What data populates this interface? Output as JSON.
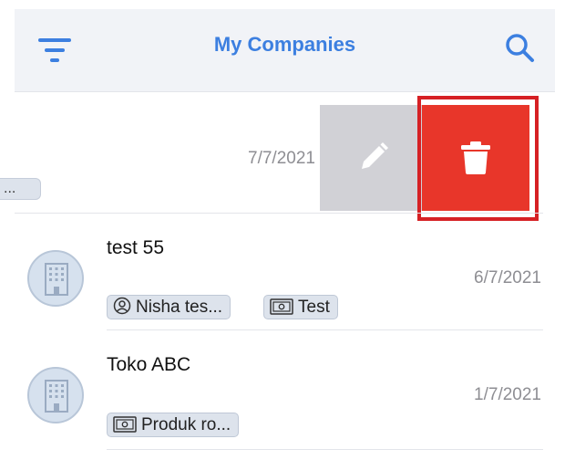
{
  "header": {
    "title": "My Companies",
    "filter_icon": "filter-icon",
    "search_icon": "search-icon",
    "accent_color": "#3c7fe0"
  },
  "swiped_row": {
    "date": "7/7/2021",
    "chip_text": "...",
    "actions": {
      "edit_icon": "pencil-icon",
      "delete_icon": "trash-icon",
      "delete_color": "#e8362a"
    }
  },
  "companies": [
    {
      "name": "test 55",
      "date": "6/7/2021",
      "chips": [
        {
          "icon": "person-circle-icon",
          "label": "Nisha tes..."
        },
        {
          "icon": "money-icon",
          "label": "Test"
        }
      ]
    },
    {
      "name": "Toko ABC",
      "date": "1/7/2021",
      "chips": [
        {
          "icon": "money-icon",
          "label": "Produk ro..."
        }
      ]
    }
  ]
}
